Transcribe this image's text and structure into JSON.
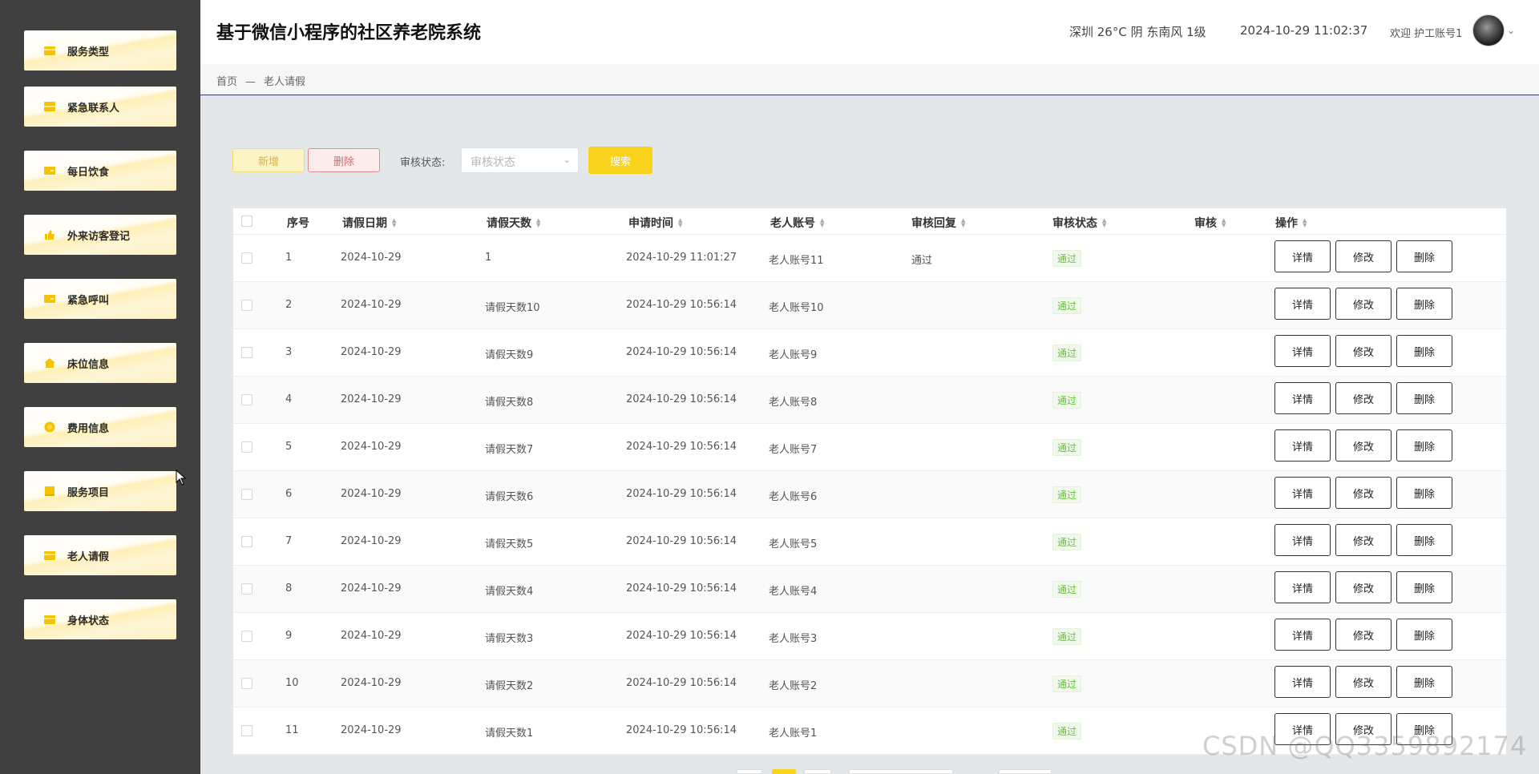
{
  "app": {
    "title": "基于微信小程序的社区养老院系统"
  },
  "header": {
    "weather": "深圳 26°C 阴 东南风 1级",
    "datetime": "2024-10-29 11:02:37",
    "welcome": "欢迎 护工账号1",
    "caret": "⌄"
  },
  "sidebar": {
    "items": [
      {
        "label": "服务类型",
        "icon": "folder-icon"
      },
      {
        "label": "紧急联系人",
        "icon": "list-icon"
      },
      {
        "label": "每日饮食",
        "icon": "card-icon"
      },
      {
        "label": "外来访客登记",
        "icon": "thumbs-up-icon"
      },
      {
        "label": "紧急呼叫",
        "icon": "card-icon"
      },
      {
        "label": "床位信息",
        "icon": "home-icon"
      },
      {
        "label": "费用信息",
        "icon": "coin-icon"
      },
      {
        "label": "服务项目",
        "icon": "book-icon"
      },
      {
        "label": "老人请假",
        "icon": "folder-icon"
      },
      {
        "label": "身体状态",
        "icon": "folder-icon"
      }
    ]
  },
  "breadcrumb": {
    "home": "首页",
    "sep": "—",
    "current": "老人请假"
  },
  "toolbar": {
    "add_label": "新增",
    "delete_label": "删除",
    "filter_label": "审核状态:",
    "filter_placeholder": "审核状态",
    "search_label": "搜索"
  },
  "table": {
    "headers": [
      "序号",
      "请假日期",
      "请假天数",
      "申请时间",
      "老人账号",
      "审核回复",
      "审核状态",
      "审核",
      "操作"
    ],
    "actions": {
      "detail": "详情",
      "edit": "修改",
      "delete": "删除"
    },
    "rows": [
      {
        "no": "1",
        "date": "2024-10-29",
        "days": "1",
        "applied": "2024-10-29 11:01:27",
        "account": "老人账号11",
        "reply": "通过",
        "status": "通过"
      },
      {
        "no": "2",
        "date": "2024-10-29",
        "days": "请假天数10",
        "applied": "2024-10-29 10:56:14",
        "account": "老人账号10",
        "reply": "",
        "status": "通过"
      },
      {
        "no": "3",
        "date": "2024-10-29",
        "days": "请假天数9",
        "applied": "2024-10-29 10:56:14",
        "account": "老人账号9",
        "reply": "",
        "status": "通过"
      },
      {
        "no": "4",
        "date": "2024-10-29",
        "days": "请假天数8",
        "applied": "2024-10-29 10:56:14",
        "account": "老人账号8",
        "reply": "",
        "status": "通过"
      },
      {
        "no": "5",
        "date": "2024-10-29",
        "days": "请假天数7",
        "applied": "2024-10-29 10:56:14",
        "account": "老人账号7",
        "reply": "",
        "status": "通过"
      },
      {
        "no": "6",
        "date": "2024-10-29",
        "days": "请假天数6",
        "applied": "2024-10-29 10:56:14",
        "account": "老人账号6",
        "reply": "",
        "status": "通过"
      },
      {
        "no": "7",
        "date": "2024-10-29",
        "days": "请假天数5",
        "applied": "2024-10-29 10:56:14",
        "account": "老人账号5",
        "reply": "",
        "status": "通过"
      },
      {
        "no": "8",
        "date": "2024-10-29",
        "days": "请假天数4",
        "applied": "2024-10-29 10:56:14",
        "account": "老人账号4",
        "reply": "",
        "status": "通过"
      },
      {
        "no": "9",
        "date": "2024-10-29",
        "days": "请假天数3",
        "applied": "2024-10-29 10:56:14",
        "account": "老人账号3",
        "reply": "",
        "status": "通过"
      },
      {
        "no": "10",
        "date": "2024-10-29",
        "days": "请假天数2",
        "applied": "2024-10-29 10:56:14",
        "account": "老人账号2",
        "reply": "",
        "status": "通过"
      },
      {
        "no": "11",
        "date": "2024-10-29",
        "days": "请假天数1",
        "applied": "2024-10-29 10:56:14",
        "account": "老人账号1",
        "reply": "",
        "status": "通过"
      }
    ]
  },
  "watermark": "CSDN @QQ3359892174",
  "colors": {
    "sidebar_bg": "#404040",
    "accent": "#f9d21c",
    "status_green": "#67c23a",
    "icon_gold": "#f5c400"
  }
}
